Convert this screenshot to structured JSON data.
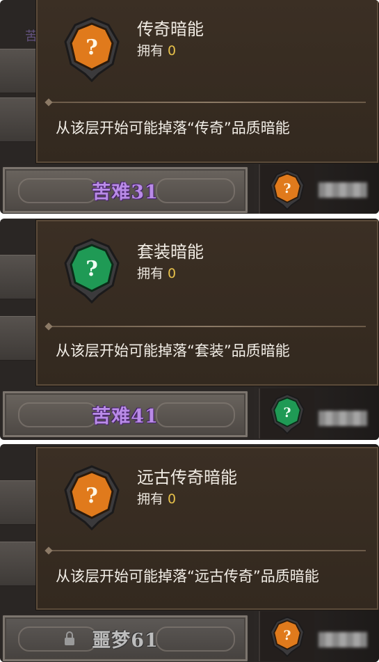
{
  "screens": [
    {
      "tooltip": {
        "title": "传奇暗能",
        "owned_label": "拥有",
        "owned_count": "0",
        "description": "从该层开始可能掉落“传奇”品质暗能",
        "icon": "orange-unknown-rune-icon",
        "icon_color": "#e07a1c"
      },
      "row": {
        "label": "苦难31",
        "locked": false
      },
      "faint_text": "苦"
    },
    {
      "tooltip": {
        "title": "套装暗能",
        "owned_label": "拥有",
        "owned_count": "0",
        "description": "从该层开始可能掉落“套装”品质暗能",
        "icon": "green-unknown-rune-icon",
        "icon_color": "#1f9a55"
      },
      "row": {
        "label": "苦难41",
        "locked": false
      }
    },
    {
      "tooltip": {
        "title": "远古传奇暗能",
        "owned_label": "拥有",
        "owned_count": "0",
        "description": "从该层开始可能掉落“远古传奇”品质暗能",
        "icon": "orange-unknown-rune-icon",
        "icon_color": "#e07a1c"
      },
      "row": {
        "label": "噩梦61",
        "locked": true
      }
    }
  ],
  "colors": {
    "owned_number": "#e6c04a",
    "torment_label": "#b98be6",
    "nightmare_label": "#bdbdbd"
  }
}
